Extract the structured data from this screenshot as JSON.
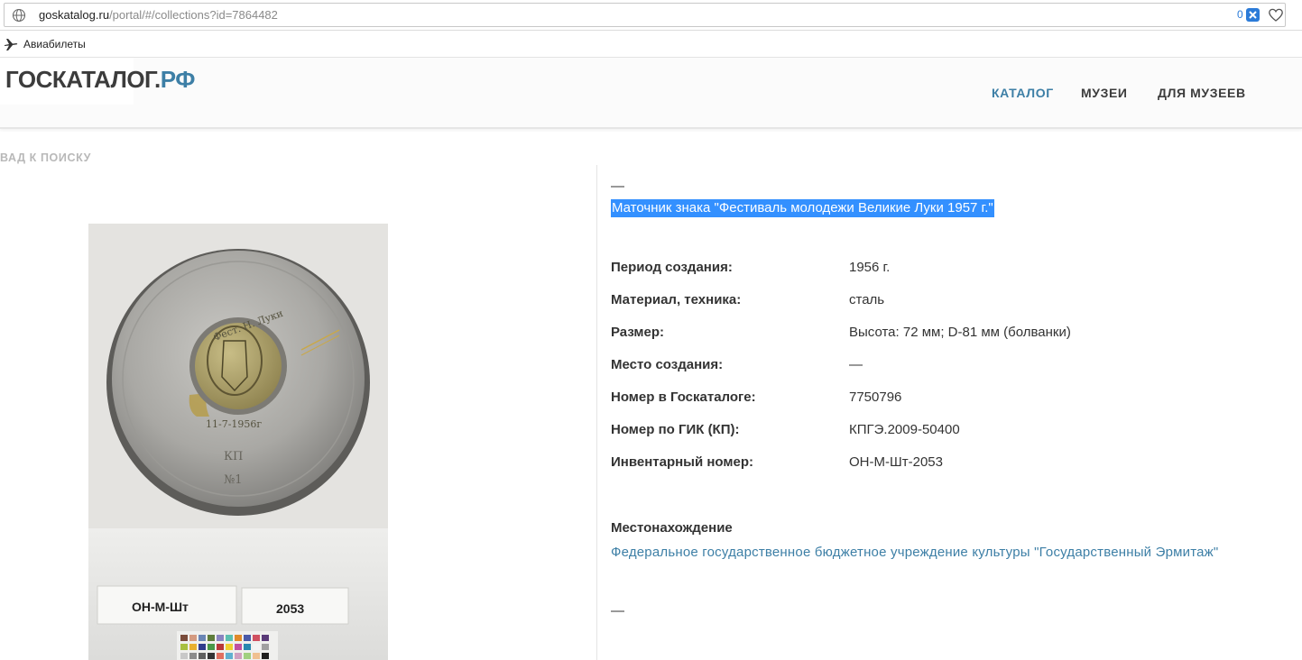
{
  "browser": {
    "url_host": "goskatalog.ru",
    "url_path": "/portal/#/collections?id=7864482",
    "badge_count": "0",
    "bookmarks": [
      {
        "label": "Авиабилеты"
      }
    ]
  },
  "header": {
    "logo_main": "ГОСКАТАЛОГ.",
    "logo_accent": "РФ",
    "nav": [
      {
        "label": "КАТАЛОГ"
      },
      {
        "label": "МУЗЕИ"
      },
      {
        "label": "ДЛЯ МУЗЕЕВ"
      }
    ]
  },
  "back_link": "ВАД К ПОИСКУ",
  "photo": {
    "stamp_text": "Фест. Н. Луки",
    "date_text": "11-7-1956г",
    "kp_text": "КП",
    "num_text": "№1",
    "label_left": "ОН-М-Шт",
    "label_right": "2053"
  },
  "item": {
    "dash_top": "—",
    "title": "Маточник знака \"Фестиваль молодежи Великие Луки 1957 г.\"",
    "fields": [
      {
        "label": "Период создания:",
        "value": "1956 г."
      },
      {
        "label": "Материал, техника:",
        "value": "сталь"
      },
      {
        "label": "Размер:",
        "value": "Высота: 72 мм; D-81 мм (болванки)"
      },
      {
        "label": "Место создания:",
        "value": "—"
      },
      {
        "label": "Номер в Госкаталоге:",
        "value": "7750796"
      },
      {
        "label": "Номер по ГИК (КП):",
        "value": "КПГЭ.2009-50400"
      },
      {
        "label": "Инвентарный номер:",
        "value": "ОН-М-Шт-2053"
      }
    ],
    "location_heading": "Местонахождение",
    "location_value": "Федеральное государственное бюджетное учреждение культуры \"Государственный Эрмитаж\"",
    "dash_bottom": "—"
  }
}
